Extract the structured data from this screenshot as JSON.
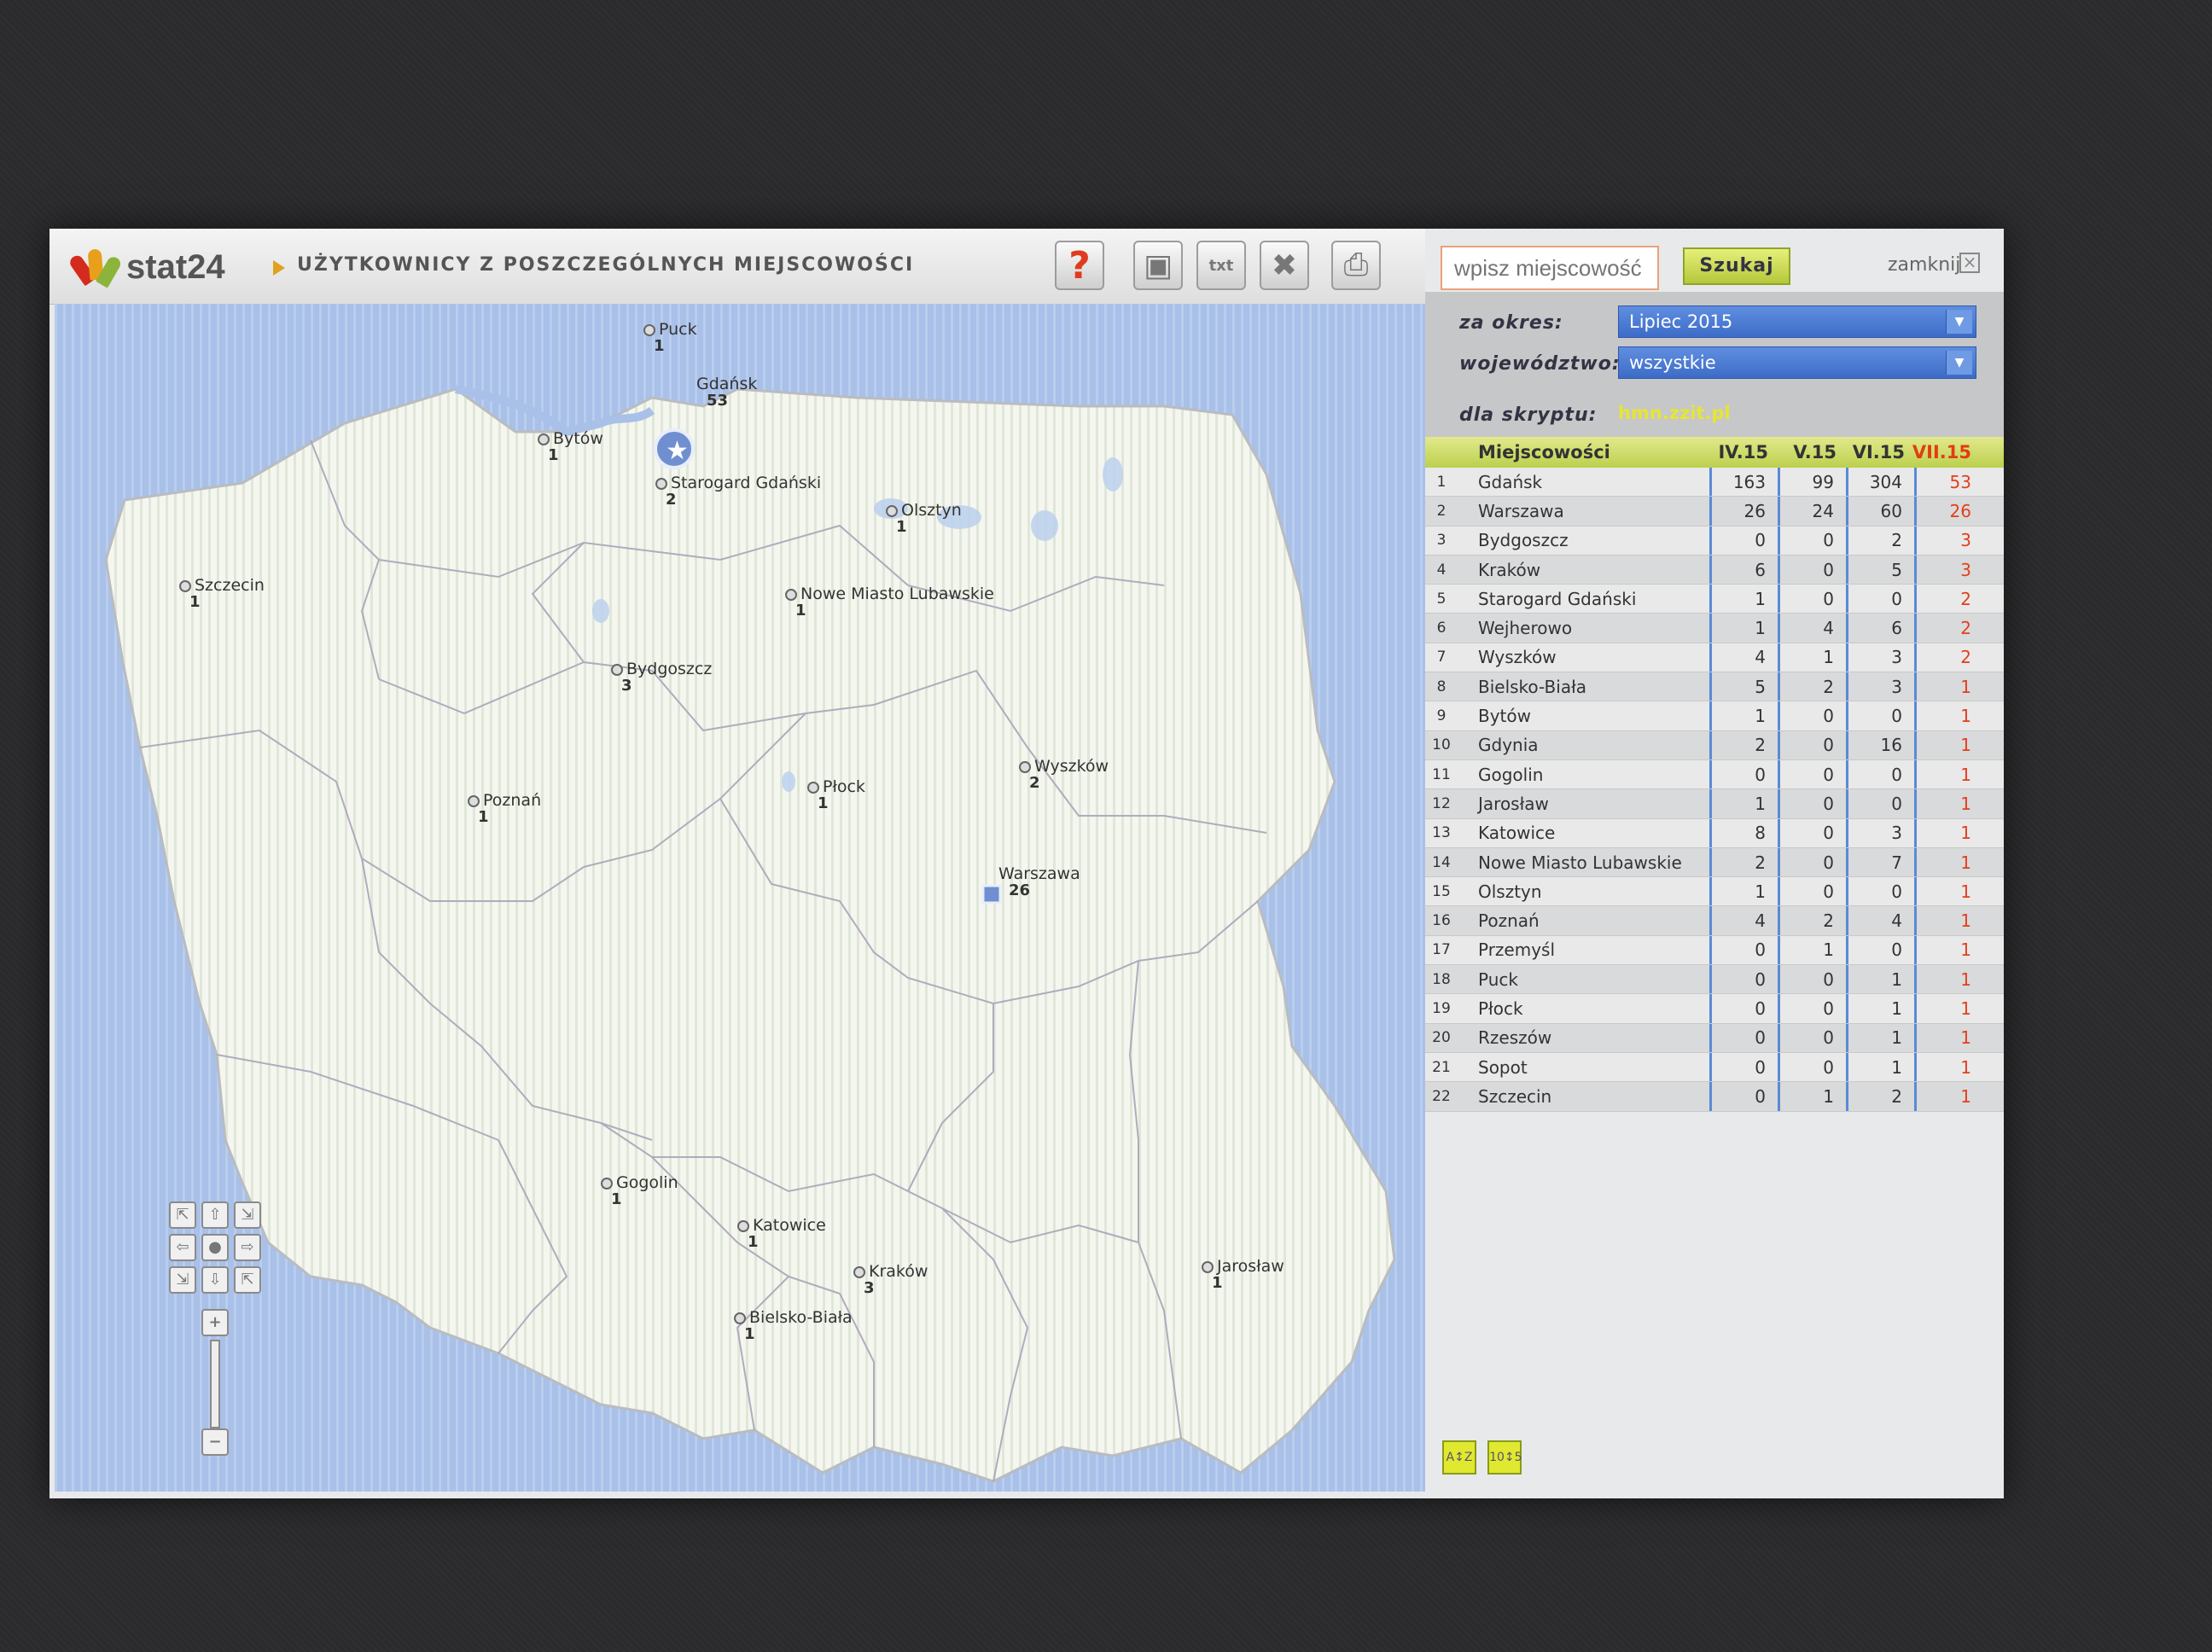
{
  "header": {
    "logo_text": "stat24",
    "title": "UŻYTKOWNICY Z POSZCZEGÓLNYCH MIEJSCOWOŚCI",
    "toolbar_icons": [
      "help-icon",
      "save-icon",
      "txt-export-icon",
      "xls-export-icon",
      "print-icon"
    ]
  },
  "search": {
    "placeholder": "wpisz miejscowość",
    "button_label": "Szukaj",
    "close_label": "zamknij"
  },
  "filters": {
    "period_label": "za okres:",
    "period_value": "Lipiec 2015",
    "region_label": "województwo:",
    "region_value": "wszystkie",
    "script_label": "dla skryptu:",
    "script_value": "hmn.zzit.pl"
  },
  "table": {
    "headers": [
      "Miejscowości",
      "IV.15",
      "V.15",
      "VI.15",
      "VII.15"
    ],
    "rows": [
      {
        "i": "1",
        "name": "Gdańsk",
        "v": [
          "163",
          "99",
          "304",
          "53"
        ]
      },
      {
        "i": "2",
        "name": "Warszawa",
        "v": [
          "26",
          "24",
          "60",
          "26"
        ]
      },
      {
        "i": "3",
        "name": "Bydgoszcz",
        "v": [
          "0",
          "0",
          "2",
          "3"
        ]
      },
      {
        "i": "4",
        "name": "Kraków",
        "v": [
          "6",
          "0",
          "5",
          "3"
        ]
      },
      {
        "i": "5",
        "name": "Starogard Gdański",
        "v": [
          "1",
          "0",
          "0",
          "2"
        ]
      },
      {
        "i": "6",
        "name": "Wejherowo",
        "v": [
          "1",
          "4",
          "6",
          "2"
        ]
      },
      {
        "i": "7",
        "name": "Wyszków",
        "v": [
          "4",
          "1",
          "3",
          "2"
        ]
      },
      {
        "i": "8",
        "name": "Bielsko-Biała",
        "v": [
          "5",
          "2",
          "3",
          "1"
        ]
      },
      {
        "i": "9",
        "name": "Bytów",
        "v": [
          "1",
          "0",
          "0",
          "1"
        ]
      },
      {
        "i": "10",
        "name": "Gdynia",
        "v": [
          "2",
          "0",
          "16",
          "1"
        ]
      },
      {
        "i": "11",
        "name": "Gogolin",
        "v": [
          "0",
          "0",
          "0",
          "1"
        ]
      },
      {
        "i": "12",
        "name": "Jarosław",
        "v": [
          "1",
          "0",
          "0",
          "1"
        ]
      },
      {
        "i": "13",
        "name": "Katowice",
        "v": [
          "8",
          "0",
          "3",
          "1"
        ]
      },
      {
        "i": "14",
        "name": "Nowe Miasto Lubawskie",
        "v": [
          "2",
          "0",
          "7",
          "1"
        ]
      },
      {
        "i": "15",
        "name": "Olsztyn",
        "v": [
          "1",
          "0",
          "0",
          "1"
        ]
      },
      {
        "i": "16",
        "name": "Poznań",
        "v": [
          "4",
          "2",
          "4",
          "1"
        ]
      },
      {
        "i": "17",
        "name": "Przemyśl",
        "v": [
          "0",
          "1",
          "0",
          "1"
        ]
      },
      {
        "i": "18",
        "name": "Puck",
        "v": [
          "0",
          "0",
          "1",
          "1"
        ]
      },
      {
        "i": "19",
        "name": "Płock",
        "v": [
          "0",
          "0",
          "1",
          "1"
        ]
      },
      {
        "i": "20",
        "name": "Rzeszów",
        "v": [
          "0",
          "0",
          "1",
          "1"
        ]
      },
      {
        "i": "21",
        "name": "Sopot",
        "v": [
          "0",
          "0",
          "1",
          "1"
        ]
      },
      {
        "i": "22",
        "name": "Szczecin",
        "v": [
          "0",
          "1",
          "2",
          "1"
        ]
      }
    ]
  },
  "map": {
    "cities": [
      {
        "name": "Puck",
        "count": "1"
      },
      {
        "name": "Gdańsk",
        "count": "53"
      },
      {
        "name": "Bytów",
        "count": "1"
      },
      {
        "name": "Starogard Gdański",
        "count": "2"
      },
      {
        "name": "Olsztyn",
        "count": "1"
      },
      {
        "name": "Szczecin",
        "count": "1"
      },
      {
        "name": "Nowe Miasto Lubawskie",
        "count": "1"
      },
      {
        "name": "Bydgoszcz",
        "count": "3"
      },
      {
        "name": "Wyszków",
        "count": "2"
      },
      {
        "name": "Płock",
        "count": "1"
      },
      {
        "name": "Poznań",
        "count": "1"
      },
      {
        "name": "Warszawa",
        "count": "26"
      },
      {
        "name": "Gogolin",
        "count": "1"
      },
      {
        "name": "Katowice",
        "count": "1"
      },
      {
        "name": "Kraków",
        "count": "3"
      },
      {
        "name": "Jarosław",
        "count": "1"
      },
      {
        "name": "Bielsko-Biała",
        "count": "1"
      }
    ]
  },
  "sort": {
    "alpha_label": "A↕Z",
    "numeric_label": "10↕5"
  },
  "colors": {
    "accent": "#e2401c",
    "select": "#4a78d2",
    "header_green": "#c8d85a"
  }
}
